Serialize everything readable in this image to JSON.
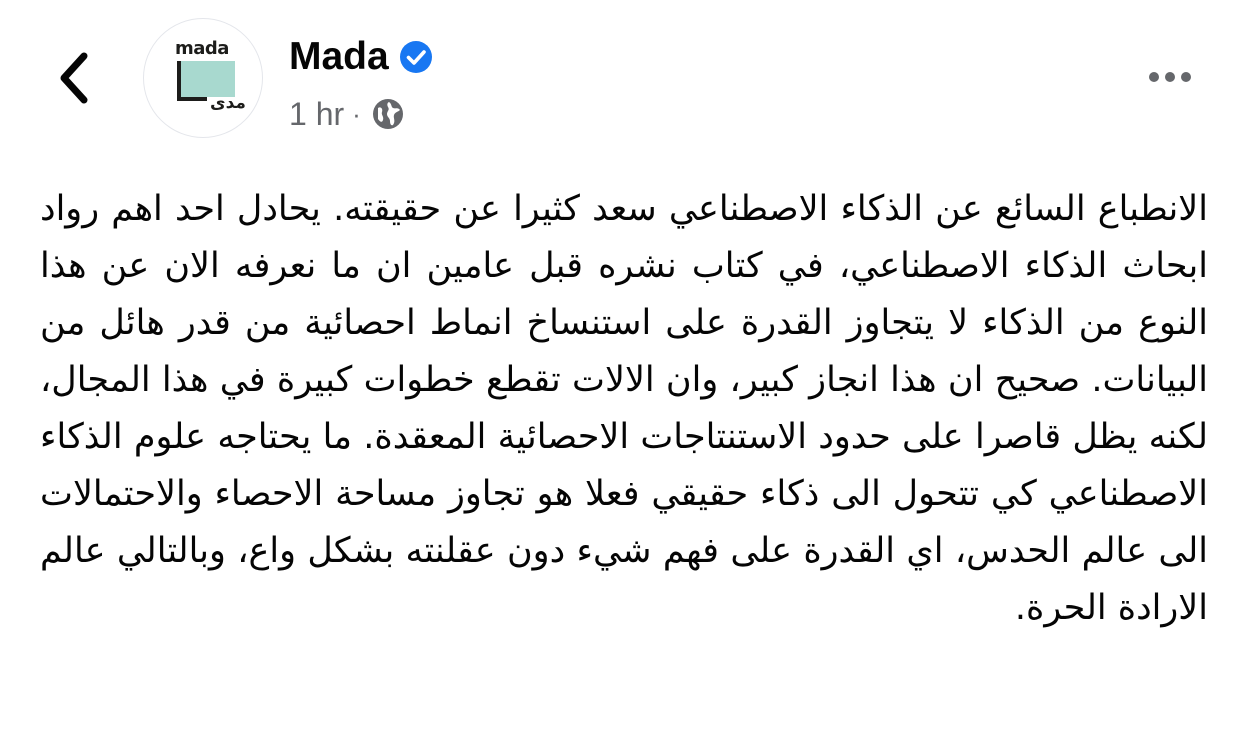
{
  "header": {
    "back_icon": "chevron-left-icon",
    "avatar": {
      "logo_word": "mada",
      "logo_arabic": "مدى",
      "brand_color": "#a8d9cf"
    },
    "page_name": "Mada",
    "verified_icon": "verified-badge-icon",
    "verified_color": "#1877f2",
    "timestamp": "1 hr",
    "separator": "·",
    "audience_icon": "globe-icon",
    "more_icon": "more-options-icon"
  },
  "post": {
    "text": "الانطباع السائع عن الذكاء الاصطناعي سعد كثيرا عن حقيقته. يحادل احد اهم رواد ابحاث الذكاء الاصطناعي، في كتاب نشره قبل عامين ان ما نعرفه الان عن هذا النوع من الذكاء لا يتجاوز القدرة على استنساخ انماط احصائية من قدر هائل من البيانات. صحيح ان هذا انجاز كبير، وان الالات تقطع خطوات كبيرة في هذا المجال، لكنه يظل قاصرا على حدود الاستنتاجات الاحصائية المعقدة. ما يحتاجه علوم الذكاء الاصطناعي كي تتحول الى ذكاء حقيقي فعلا هو تجاوز مساحة الاحصاء والاحتمالات الى عالم الحدس، اي القدرة على فهم شيء دون عقلنته بشكل واع، وبالتالي عالم الارادة الحرة."
  }
}
